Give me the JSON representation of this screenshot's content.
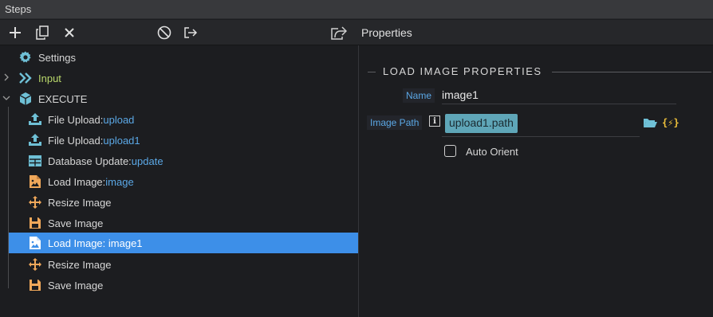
{
  "window": {
    "title": "Steps"
  },
  "toolbar": {
    "add_icon": "plus-icon",
    "copy_icon": "copy-icon",
    "delete_icon": "close-icon",
    "disable_icon": "disable-icon",
    "export_icon": "export-icon",
    "share_icon": "share-icon",
    "properties_title": "Properties"
  },
  "tree": {
    "items": [
      {
        "label": "Settings",
        "value": "",
        "icon": "gear-icon"
      },
      {
        "label": "Input",
        "value": "",
        "icon": "double-chevron-icon"
      },
      {
        "label": "EXECUTE",
        "value": "",
        "icon": "cube-icon"
      },
      {
        "label": "File Upload: ",
        "value": "upload",
        "icon": "upload-icon"
      },
      {
        "label": "File Upload: ",
        "value": "upload1",
        "icon": "upload-icon"
      },
      {
        "label": "Database Update: ",
        "value": "update",
        "icon": "table-icon"
      },
      {
        "label": "Load Image: ",
        "value": "image",
        "icon": "image-file-icon"
      },
      {
        "label": "Resize Image",
        "value": "",
        "icon": "move-arrows-icon"
      },
      {
        "label": "Save Image",
        "value": "",
        "icon": "floppy-disk-icon"
      },
      {
        "label": "Load Image: image1",
        "value": "",
        "icon": "image-file-icon",
        "selected": true
      },
      {
        "label": "Resize Image",
        "value": "",
        "icon": "move-arrows-icon"
      },
      {
        "label": "Save Image",
        "value": "",
        "icon": "floppy-disk-icon"
      }
    ]
  },
  "properties": {
    "section_title": "LOAD IMAGE PROPERTIES",
    "name_label": "Name",
    "name_value": "image1",
    "path_label": "Image Path",
    "info_glyph": "i",
    "path_value": "upload1.path",
    "folder_icon": "folder-open-icon",
    "dynamic_glyph": "{⚡}",
    "auto_orient_label": "Auto Orient",
    "auto_orient_checked": false
  },
  "colors": {
    "selection": "#3d8fe8",
    "value_text": "#5ba8e6",
    "input_text": "#b9d86b",
    "icon_orange": "#f0a85a",
    "icon_teal": "#6fc0d6",
    "token_bg": "#5fa6b8"
  }
}
